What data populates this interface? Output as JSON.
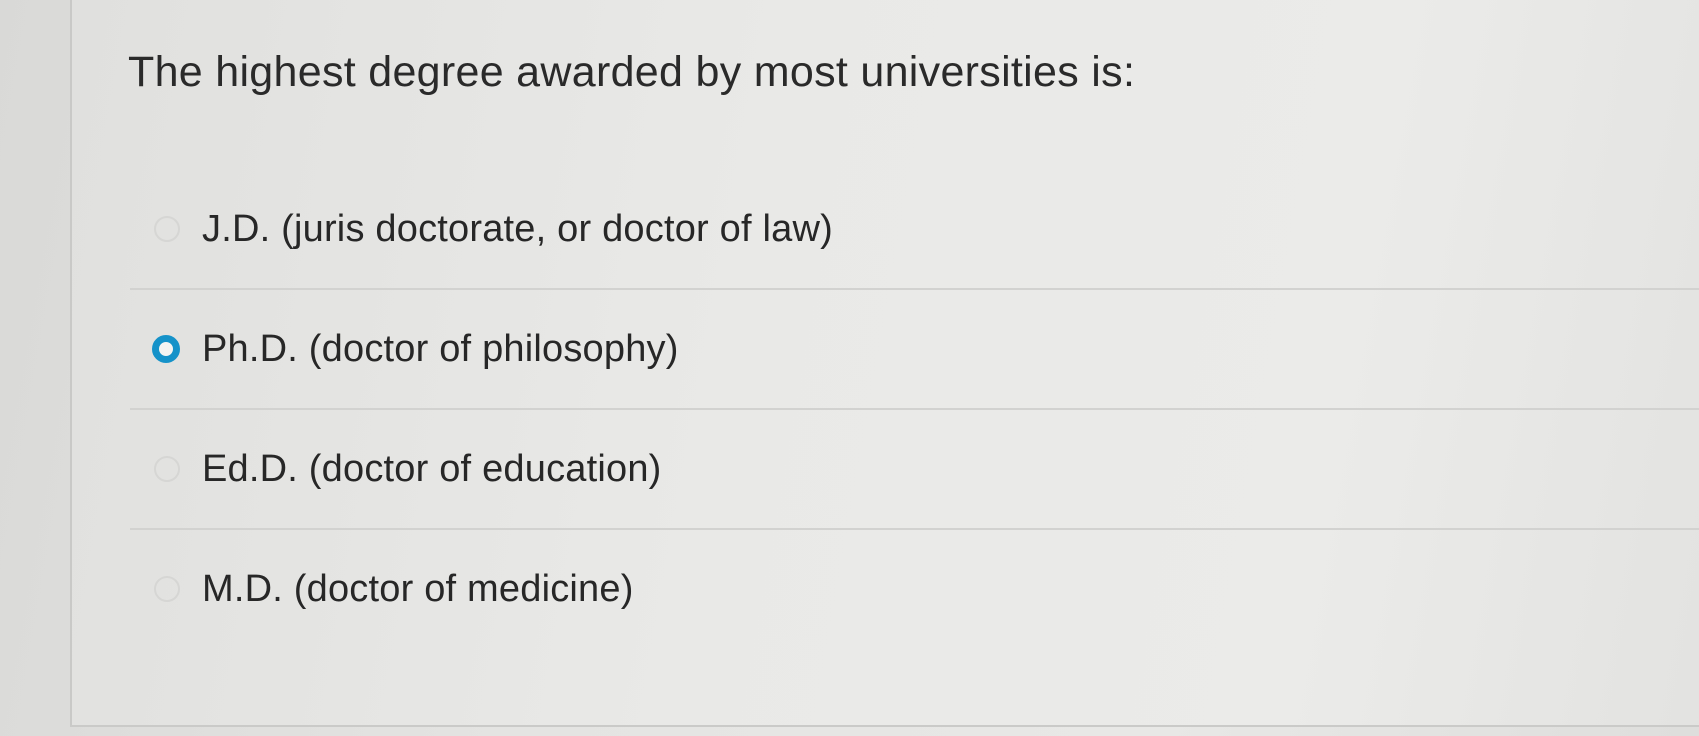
{
  "question": {
    "text": "The highest degree awarded by most universities is:"
  },
  "options": [
    {
      "label": "J.D. (juris doctorate, or doctor of law)",
      "selected": false
    },
    {
      "label": "Ph.D. (doctor of philosophy)",
      "selected": true
    },
    {
      "label": "Ed.D. (doctor of education)",
      "selected": false
    },
    {
      "label": "M.D. (doctor of medicine)",
      "selected": false
    }
  ],
  "colors": {
    "accent": "#1592c9",
    "background": "#e6e6e4",
    "text": "#2a2a2a"
  },
  "icons": {
    "radio_unselected": "radio-empty-icon",
    "radio_selected": "radio-checked-icon"
  }
}
